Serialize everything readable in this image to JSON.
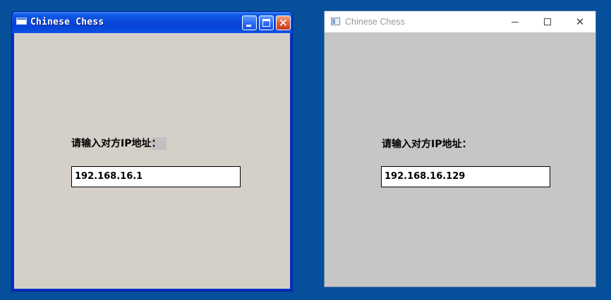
{
  "desktop": {
    "background_color": "#064f9a"
  },
  "windows": [
    {
      "theme": "classic-xp",
      "title": "Chinese Chess",
      "controls": {
        "minimize": "minimize",
        "maximize": "maximize",
        "close": "✕"
      },
      "ip_label": "请输入对方IP地址：",
      "ip_value": "192.168.16.1",
      "client_bg": "#d4d0c8",
      "titlebar_color": "#0a48d9"
    },
    {
      "theme": "windows-10",
      "title": "Chinese Chess",
      "controls": {
        "minimize": "minimize",
        "maximize": "maximize",
        "close": "✕"
      },
      "ip_label": "请输入对方IP地址：",
      "ip_value": "192.168.16.129",
      "client_bg": "#c6c6c6",
      "titlebar_color": "#ffffff"
    }
  ]
}
